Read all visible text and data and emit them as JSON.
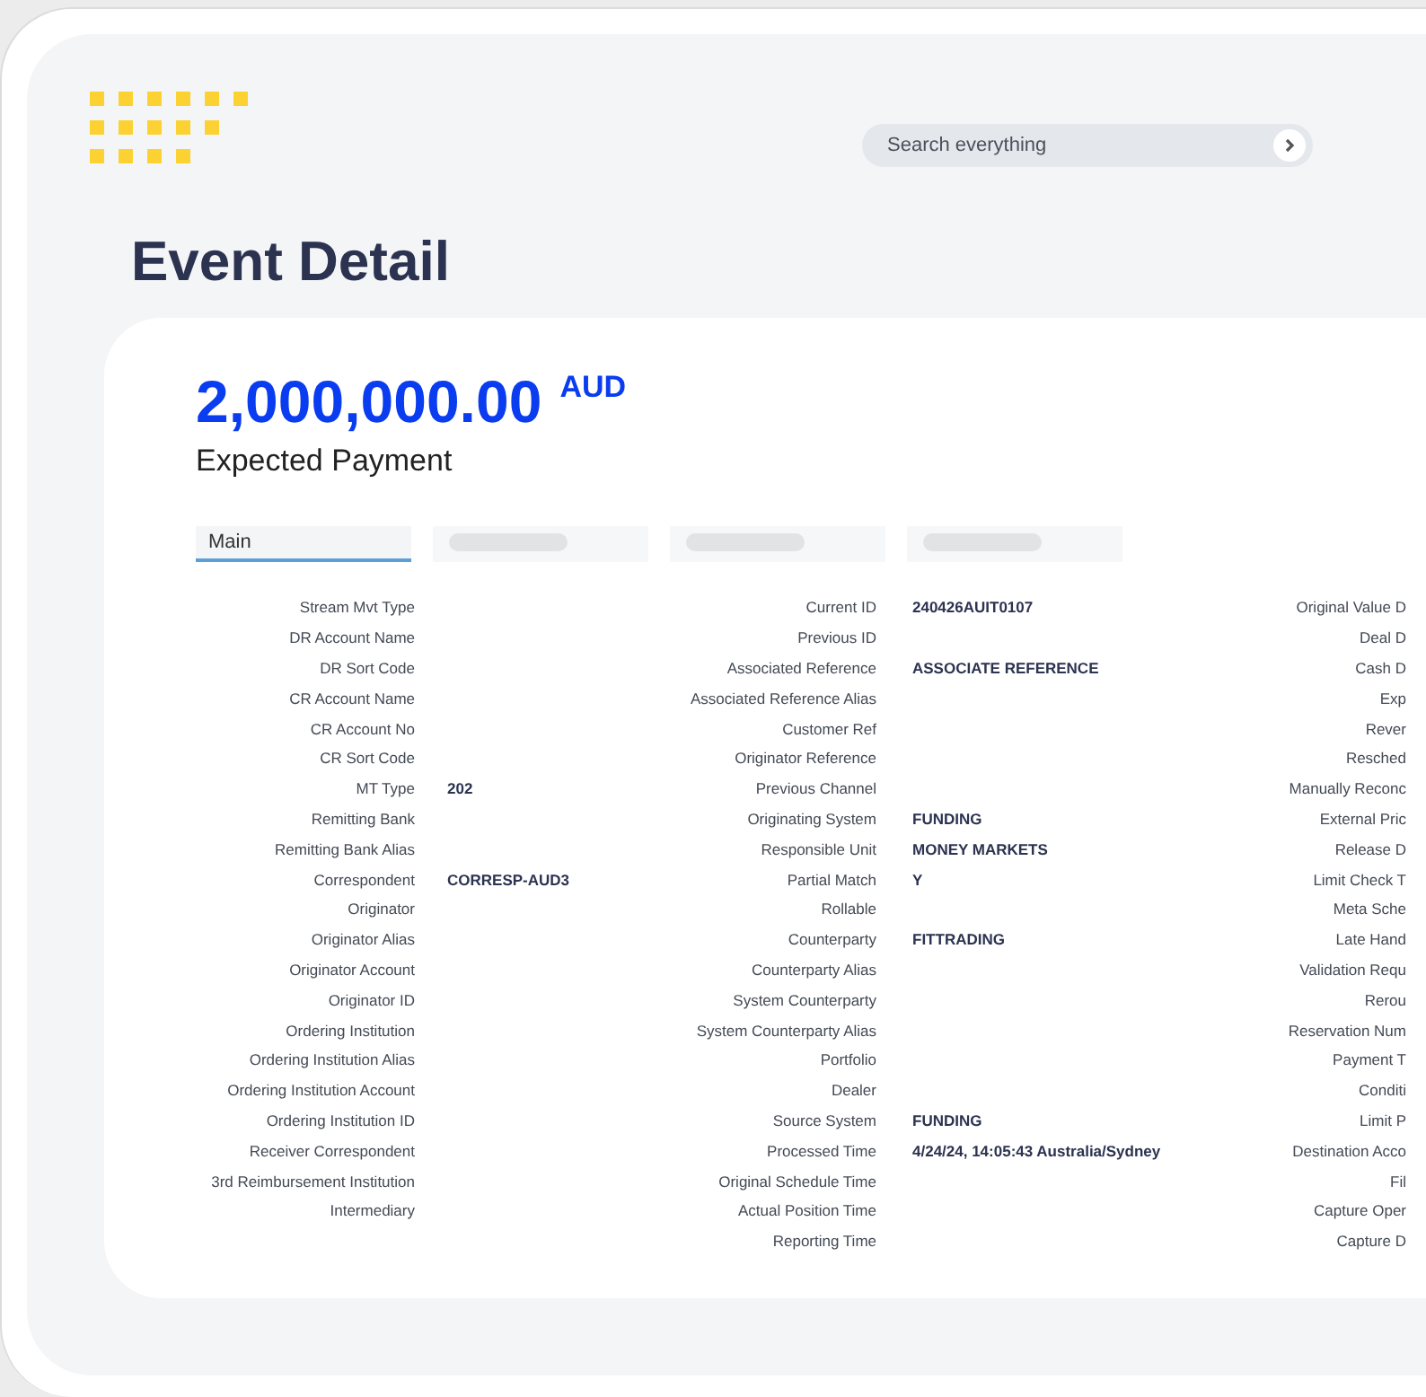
{
  "search": {
    "placeholder": "Search everything"
  },
  "page_title": "Event Detail",
  "amount": {
    "value": "2,000,000.00",
    "currency": "AUD",
    "caption": "Expected Payment"
  },
  "tabs": [
    {
      "kind": "label",
      "label": "Main",
      "selected": true
    },
    {
      "kind": "skeleton",
      "selected": false
    },
    {
      "kind": "skeleton",
      "selected": false
    },
    {
      "kind": "skeleton",
      "selected": false
    }
  ],
  "field_columns": [
    [
      {
        "label": "Stream Mvt Type"
      },
      {
        "label": "DR Account Name"
      },
      {
        "label": "DR Sort Code"
      },
      {
        "label": "CR Account Name"
      },
      {
        "label": "CR Account No"
      },
      {
        "label": "CR Sort Code"
      },
      {
        "label": "MT Type",
        "value": "202"
      },
      {
        "label": "Remitting Bank"
      },
      {
        "label": "Remitting Bank Alias"
      },
      {
        "label": "Correspondent",
        "value": "CORRESP-AUD3"
      },
      {
        "label": "Originator"
      },
      {
        "label": "Originator Alias"
      },
      {
        "label": "Originator Account"
      },
      {
        "label": "Originator ID"
      },
      {
        "label": "Ordering Institution"
      },
      {
        "label": "Ordering Institution Alias"
      },
      {
        "label": "Ordering Institution Account"
      },
      {
        "label": "Ordering Institution ID"
      },
      {
        "label": "Receiver Correspondent"
      },
      {
        "label": "3rd Reimbursement Institution"
      },
      {
        "label": "Intermediary"
      }
    ],
    [
      {
        "label": "Current ID",
        "value": "240426AUIT0107"
      },
      {
        "label": "Previous ID"
      },
      {
        "label": "Associated Reference",
        "value": "ASSOCIATE REFERENCE"
      },
      {
        "label": "Associated Reference Alias"
      },
      {
        "label": "Customer Ref"
      },
      {
        "label": "Originator Reference"
      },
      {
        "label": "Previous Channel"
      },
      {
        "label": "Originating System",
        "value": "FUNDING"
      },
      {
        "label": "Responsible Unit",
        "value": "MONEY MARKETS"
      },
      {
        "label": "Partial Match",
        "value": "Y"
      },
      {
        "label": "Rollable"
      },
      {
        "label": "Counterparty",
        "value": "FITTRADING"
      },
      {
        "label": "Counterparty Alias"
      },
      {
        "label": "System Counterparty"
      },
      {
        "label": "System Counterparty Alias"
      },
      {
        "label": "Portfolio"
      },
      {
        "label": "Dealer"
      },
      {
        "label": "Source System",
        "value": "FUNDING"
      },
      {
        "label": "Processed Time",
        "value": "4/24/24, 14:05:43 Australia/Sydney"
      },
      {
        "label": "Original Schedule Time"
      },
      {
        "label": "Actual Position Time"
      },
      {
        "label": "Reporting Time"
      }
    ],
    [
      {
        "label": "Original Value D"
      },
      {
        "label": "Deal D"
      },
      {
        "label": "Cash D"
      },
      {
        "label": "Exp"
      },
      {
        "label": "Rever"
      },
      {
        "label": "Resched"
      },
      {
        "label": "Manually Reconc"
      },
      {
        "label": "External Pric"
      },
      {
        "label": "Release D"
      },
      {
        "label": "Limit Check T"
      },
      {
        "label": "Meta Sche"
      },
      {
        "label": "Late Hand"
      },
      {
        "label": "Validation Requ"
      },
      {
        "label": "Rerou"
      },
      {
        "label": "Reservation Num"
      },
      {
        "label": "Payment T"
      },
      {
        "label": "Conditi"
      },
      {
        "label": "Limit P"
      },
      {
        "label": "Destination Acco"
      },
      {
        "label": "Fil"
      },
      {
        "label": "Capture Oper"
      },
      {
        "label": "Capture D"
      }
    ]
  ]
}
